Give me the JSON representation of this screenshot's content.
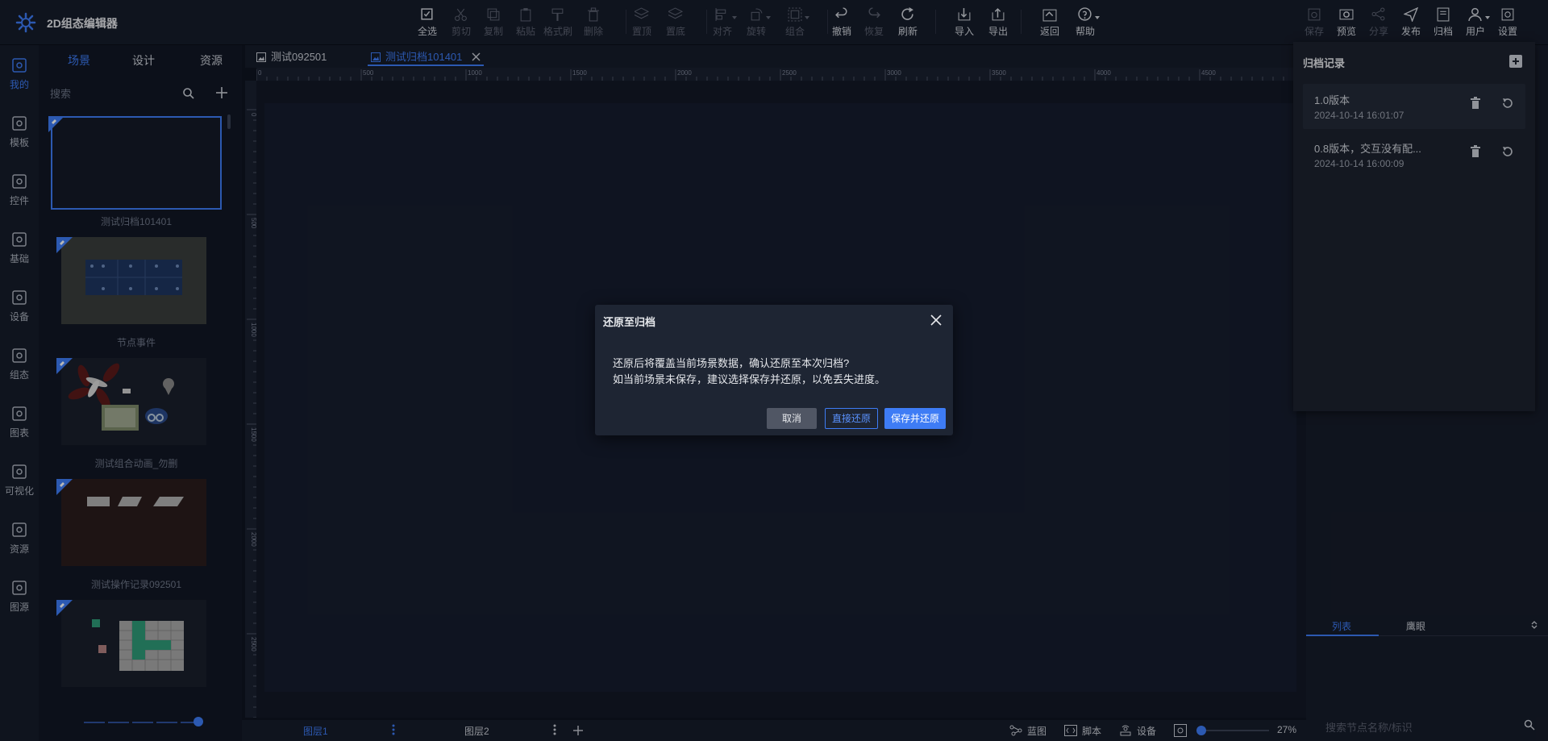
{
  "app": {
    "title": "2D组态编辑器"
  },
  "toolbar": [
    {
      "label": "全选",
      "icon": "select-all-icon",
      "disabled": false
    },
    {
      "label": "剪切",
      "icon": "cut-icon",
      "disabled": true
    },
    {
      "label": "复制",
      "icon": "copy-icon",
      "disabled": true
    },
    {
      "label": "粘贴",
      "icon": "paste-icon",
      "disabled": true
    },
    {
      "label": "格式刷",
      "icon": "format-brush-icon",
      "disabled": true
    },
    {
      "label": "删除",
      "icon": "delete-icon",
      "disabled": true
    },
    {
      "label": "置顶",
      "icon": "bring-to-top-icon",
      "disabled": true
    },
    {
      "label": "置底",
      "icon": "send-to-bottom-icon",
      "disabled": true
    },
    {
      "label": "对齐",
      "icon": "align-icon",
      "disabled": true
    },
    {
      "label": "旋转",
      "icon": "rotate-icon",
      "disabled": true
    },
    {
      "label": "组合",
      "icon": "group-icon",
      "disabled": true
    },
    {
      "label": "撤销",
      "icon": "undo-icon",
      "disabled": false
    },
    {
      "label": "恢复",
      "icon": "redo-icon",
      "disabled": true
    },
    {
      "label": "刷新",
      "icon": "refresh-icon",
      "disabled": false
    },
    {
      "label": "导入",
      "icon": "import-icon",
      "disabled": false
    },
    {
      "label": "导出",
      "icon": "export-icon",
      "disabled": false
    },
    {
      "label": "返回",
      "icon": "back-icon",
      "disabled": false
    },
    {
      "label": "帮助",
      "icon": "help-icon",
      "disabled": false
    }
  ],
  "toolbar_right": [
    {
      "label": "保存",
      "icon": "save-icon",
      "disabled": true
    },
    {
      "label": "预览",
      "icon": "preview-icon",
      "disabled": false
    },
    {
      "label": "分享",
      "icon": "share-icon",
      "disabled": true
    },
    {
      "label": "发布",
      "icon": "publish-icon",
      "disabled": false
    },
    {
      "label": "归档",
      "icon": "archive-icon",
      "disabled": false
    },
    {
      "label": "用户",
      "icon": "user-icon",
      "disabled": false
    },
    {
      "label": "设置",
      "icon": "settings-icon",
      "disabled": false
    }
  ],
  "left_nav": [
    {
      "label": "我的",
      "icon": "my-icon",
      "active": true
    },
    {
      "label": "模板",
      "icon": "template-icon",
      "active": false
    },
    {
      "label": "控件",
      "icon": "controls-icon",
      "active": false
    },
    {
      "label": "基础",
      "icon": "basic-icon",
      "active": false
    },
    {
      "label": "设备",
      "icon": "device-icon",
      "active": false
    },
    {
      "label": "组态",
      "icon": "scada-icon",
      "active": false
    },
    {
      "label": "图表",
      "icon": "chart-icon",
      "active": false
    },
    {
      "label": "可视化",
      "icon": "visualization-icon",
      "active": false
    },
    {
      "label": "资源",
      "icon": "resource-icon",
      "active": false
    },
    {
      "label": "图源",
      "icon": "image-source-icon",
      "active": false
    }
  ],
  "scene_panel": {
    "tabs": [
      {
        "label": "场景",
        "active": true
      },
      {
        "label": "设计",
        "active": false
      },
      {
        "label": "资源",
        "active": false
      }
    ],
    "search_placeholder": "搜索",
    "scenes": [
      {
        "name": "测试归档101401",
        "selected": true
      },
      {
        "name": "节点事件",
        "selected": false
      },
      {
        "name": "测试组合动画_勿删",
        "selected": false
      },
      {
        "name": "测试操作记录092501",
        "selected": false
      },
      {
        "name": "",
        "selected": false
      }
    ]
  },
  "doc_tabs": [
    {
      "label": "测试092501",
      "active": false
    },
    {
      "label": "测试归档101401",
      "active": true
    }
  ],
  "ruler": {
    "h_ticks": [
      "0",
      "500",
      "1000",
      "1500",
      "2000",
      "2500",
      "3000",
      "3500",
      "4000",
      "4500"
    ],
    "v_ticks": [
      "0",
      "500",
      "1000",
      "1500",
      "2000",
      "2500"
    ]
  },
  "bottom_bar": {
    "layers": [
      {
        "label": "图层1",
        "active": true
      },
      {
        "label": "图层2",
        "active": false
      }
    ],
    "items": [
      {
        "label": "蓝图",
        "icon": "blueprint-icon"
      },
      {
        "label": "脚本",
        "icon": "script-icon"
      },
      {
        "label": "设备",
        "icon": "device-icon"
      }
    ],
    "zoom": "27%"
  },
  "right_panel": {
    "tabs": [
      {
        "label": "列表",
        "active": true
      },
      {
        "label": "鹰眼",
        "active": false
      }
    ],
    "search_placeholder": "搜索节点名称/标识"
  },
  "archive_panel": {
    "title": "归档记录",
    "records": [
      {
        "name": "1.0版本",
        "time": "2024-10-14 16:01:07",
        "selected": true
      },
      {
        "name": "0.8版本，交互没有配...",
        "time": "2024-10-14 16:00:09",
        "selected": false
      }
    ]
  },
  "dialog": {
    "title": "还原至归档",
    "line1": "还原后将覆盖当前场景数据，确认还原至本次归档?",
    "line2": "如当前场景未保存，建议选择保存并还原，以免丢失进度。",
    "cancel": "取消",
    "direct": "直接还原",
    "save": "保存并还原"
  },
  "colors": {
    "accent": "#3e7cf5",
    "background": "#0f1420",
    "panel": "#161c2a"
  }
}
